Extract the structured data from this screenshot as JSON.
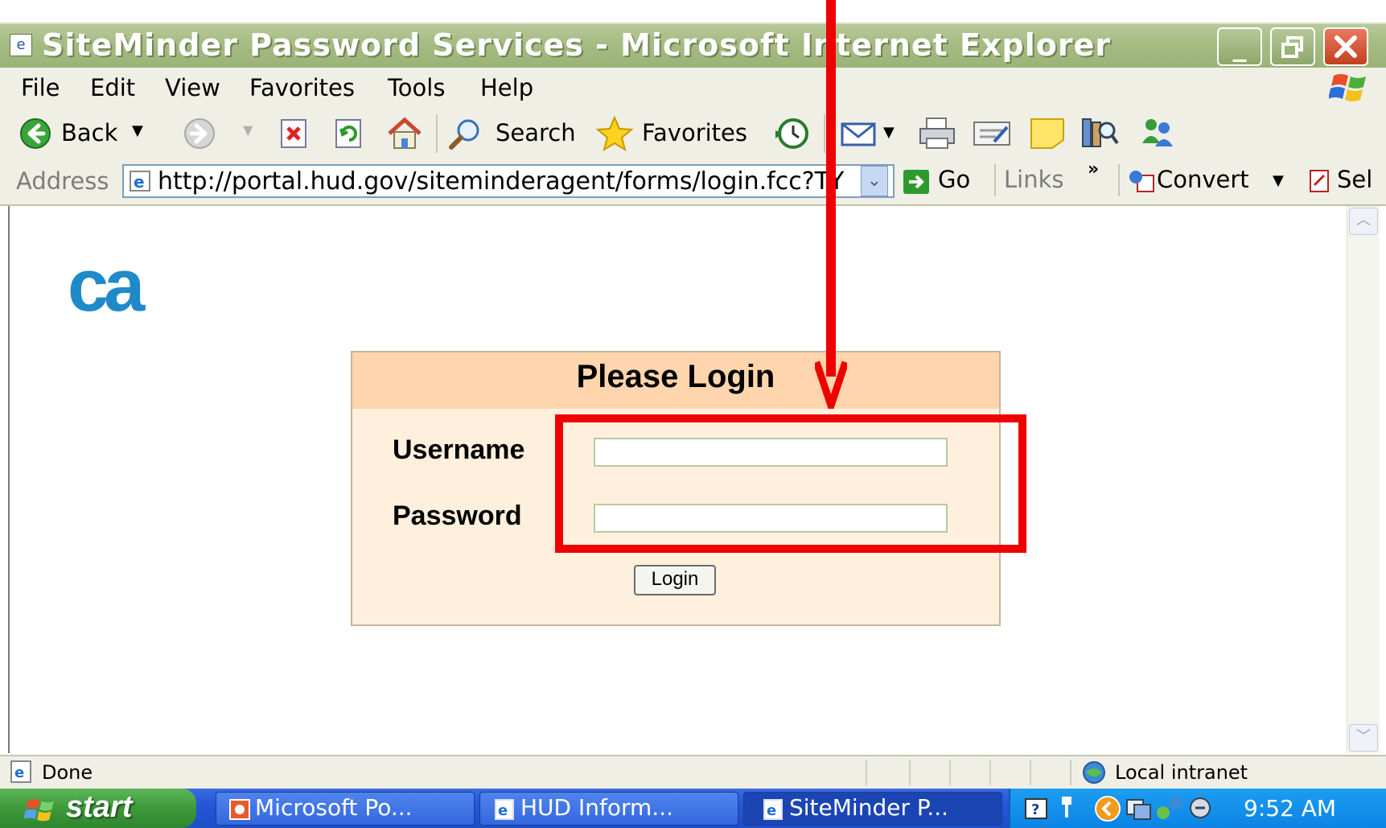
{
  "window": {
    "title": "SiteMinder Password Services - Microsoft Internet Explorer",
    "app_icon": "ie-page-icon",
    "controls": [
      "minimize-icon",
      "restore-icon",
      "close-icon"
    ]
  },
  "menu": {
    "items": [
      {
        "label": "File"
      },
      {
        "label": "Edit"
      },
      {
        "label": "View"
      },
      {
        "label": "Favorites"
      },
      {
        "label": "Tools"
      },
      {
        "label": "Help"
      }
    ]
  },
  "toolbar": {
    "back_label": "Back",
    "search_label": "Search",
    "favorites_label": "Favorites"
  },
  "address": {
    "label": "Address",
    "url": "http://portal.hud.gov/siteminderagent/forms/login.fcc?TY",
    "go_label": "Go",
    "links_label": "Links",
    "links_chevron": "»",
    "convert_label": "Convert",
    "select_label": "Sel"
  },
  "page": {
    "logo_text": "ca",
    "login_title": "Please Login",
    "username_label": "Username",
    "password_label": "Password",
    "username_value": "",
    "password_value": "",
    "login_button": "Login"
  },
  "status": {
    "text": "Done",
    "zone": "Local intranet"
  },
  "taskbar": {
    "start_label": "start",
    "tasks": [
      {
        "label": "Microsoft Po..."
      },
      {
        "label": "HUD Inform..."
      },
      {
        "label": "SiteMinder P..."
      }
    ],
    "clock": "9:52 AM"
  },
  "colors": {
    "annotation_red": "#ee0000",
    "login_header": "#ffd5ae",
    "login_body": "#fff0dd",
    "ca_logo": "#1f8ac9"
  }
}
